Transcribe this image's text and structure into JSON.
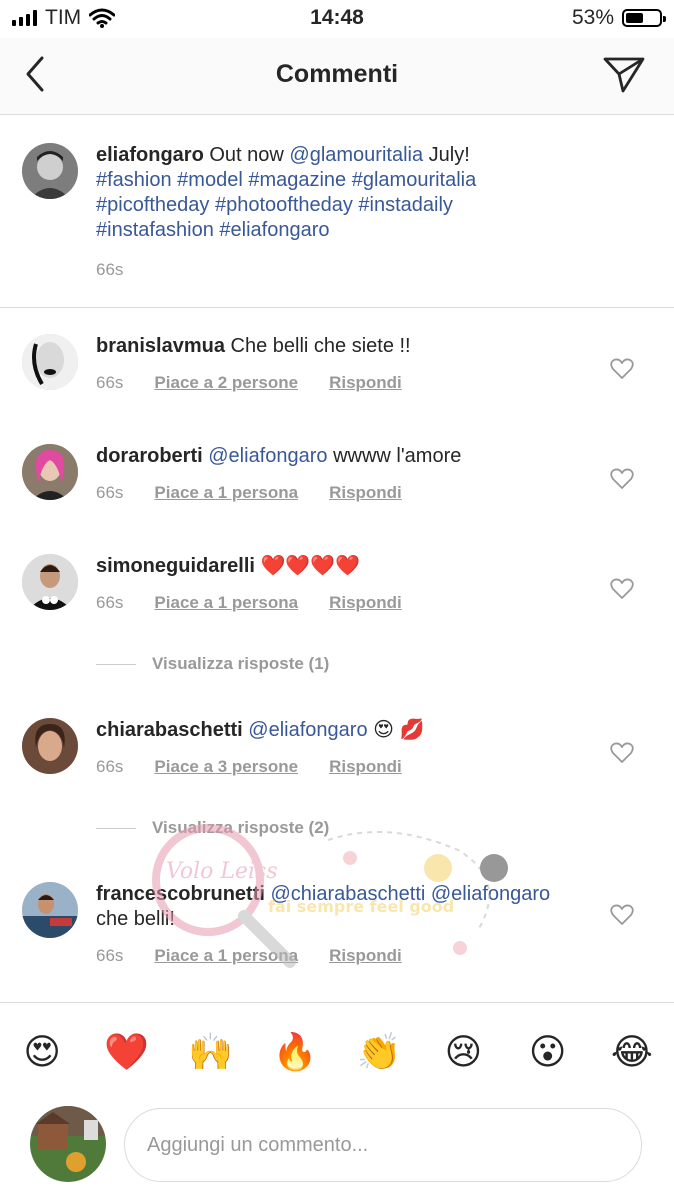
{
  "status": {
    "carrier": "TIM",
    "time": "14:48",
    "battery": "53%",
    "battery_level": 0.53
  },
  "nav": {
    "title": "Commenti"
  },
  "caption": {
    "username": "eliafongaro",
    "text_before": "Out now",
    "mention": "@glamouritalia",
    "text_after": "July!",
    "hashtags": "#fashion #model #magazine #glamouritalia #picoftheday #photooftheday #instadaily #instafashion #eliafongaro",
    "time": "66s"
  },
  "comments": [
    {
      "username": "branislavmua",
      "mention": "",
      "text": "Che belli che siete !!",
      "time": "66s",
      "likes": "Piace a 2 persone",
      "reply": "Rispondi"
    },
    {
      "username": "doraroberti",
      "mention": "@eliafongaro",
      "text": "wwww l'amore",
      "time": "66s",
      "likes": "Piace a 1 persona",
      "reply": "Rispondi"
    },
    {
      "username": "simoneguidarelli",
      "mention": "",
      "text": "❤️❤️❤️❤️",
      "time": "66s",
      "likes": "Piace a 1 persona",
      "reply": "Rispondi"
    },
    {
      "username": "chiarabaschetti",
      "mention": "@eliafongaro",
      "text": "😍 💋",
      "time": "66s",
      "likes": "Piace a 3 persone",
      "reply": "Rispondi"
    },
    {
      "username": "francescobrunetti",
      "mention": "@chiarabaschetti @eliafongaro",
      "text": "che belli!",
      "time": "66s",
      "likes": "Piace a 1 persona",
      "reply": "Rispondi"
    }
  ],
  "view_replies": [
    "Visualizza risposte (1)",
    "Visualizza risposte (2)"
  ],
  "emoji_bar": [
    "😍",
    "❤️",
    "🙌",
    "🔥",
    "👏",
    "😢",
    "😮",
    "😂"
  ],
  "input": {
    "placeholder": "Aggiungi un commento..."
  },
  "watermark": {
    "text": "Volo Leiss",
    "subtext": "fai sempre feel good"
  },
  "colors": {
    "link": "#385898",
    "muted": "#999999",
    "border": "#dbdbdb"
  }
}
